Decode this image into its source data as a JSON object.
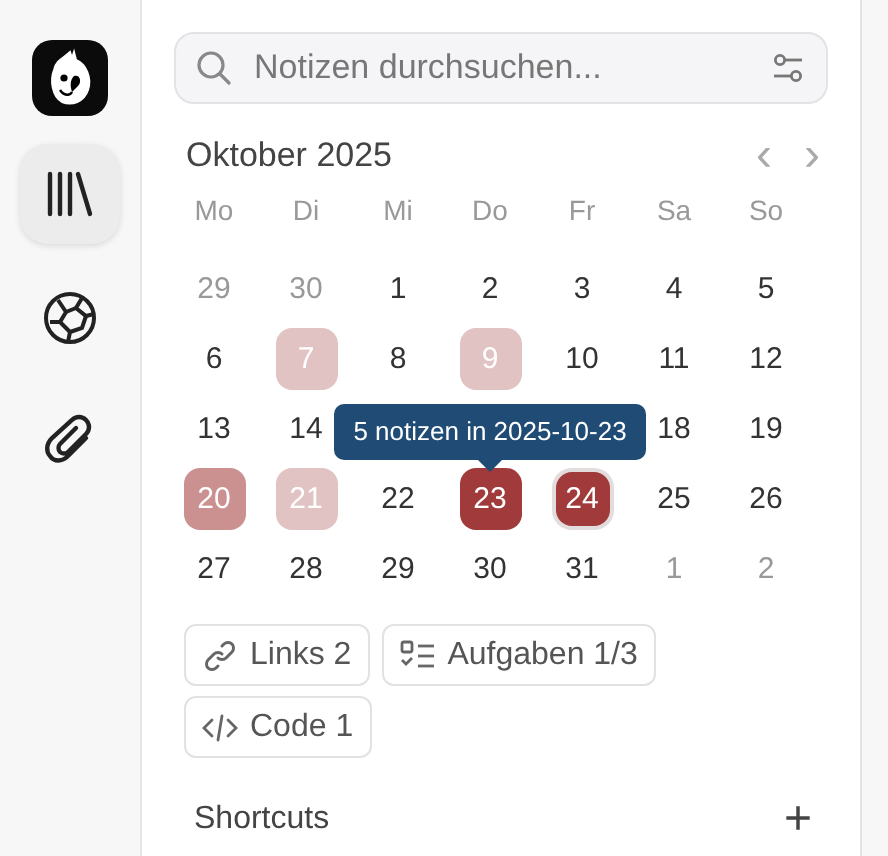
{
  "sidebar": {
    "items": [
      {
        "kind": "library",
        "selected": true
      },
      {
        "kind": "globe",
        "selected": false
      },
      {
        "kind": "attachment",
        "selected": false
      }
    ]
  },
  "search": {
    "placeholder": "Notizen durchsuchen..."
  },
  "calendar": {
    "month": "Oktober 2025",
    "prev": "‹",
    "next": "›",
    "weekdays": [
      "Mo",
      "Di",
      "Mi",
      "Do",
      "Fr",
      "Sa",
      "So"
    ],
    "tooltip": "5 notizen in 2025-10-23",
    "days": [
      {
        "label": "29",
        "in_month": false,
        "today": false
      },
      {
        "label": "30",
        "in_month": false,
        "today": false
      },
      {
        "label": "1",
        "in_month": true,
        "today": false
      },
      {
        "label": "2",
        "in_month": true,
        "today": false
      },
      {
        "label": "3",
        "in_month": true,
        "today": false
      },
      {
        "label": "4",
        "in_month": true,
        "today": false
      },
      {
        "label": "5",
        "in_month": true,
        "today": false
      },
      {
        "label": "6",
        "in_month": true,
        "today": false
      },
      {
        "label": "7",
        "in_month": true,
        "today": false,
        "color": "#e2c3c3"
      },
      {
        "label": "8",
        "in_month": true,
        "today": false
      },
      {
        "label": "9",
        "in_month": true,
        "today": false,
        "color": "#e2c3c3"
      },
      {
        "label": "10",
        "in_month": true,
        "today": false
      },
      {
        "label": "11",
        "in_month": true,
        "today": false
      },
      {
        "label": "12",
        "in_month": true,
        "today": false
      },
      {
        "label": "13",
        "in_month": true,
        "today": false
      },
      {
        "label": "14",
        "in_month": true,
        "today": false
      },
      {
        "label": "18",
        "in_month": true,
        "today": false
      },
      {
        "label": "19",
        "in_month": true,
        "today": false
      },
      {
        "label": "20",
        "in_month": true,
        "today": false,
        "color": "#cb9090"
      },
      {
        "label": "21",
        "in_month": true,
        "today": false,
        "color": "#e2c3c3"
      },
      {
        "label": "22",
        "in_month": true,
        "today": false
      },
      {
        "label": "23",
        "in_month": true,
        "today": false,
        "color": "#a13b3b"
      },
      {
        "label": "24",
        "in_month": true,
        "today": true,
        "color": "#a13b3b"
      },
      {
        "label": "25",
        "in_month": true,
        "today": false
      },
      {
        "label": "26",
        "in_month": true,
        "today": false
      },
      {
        "label": "27",
        "in_month": true,
        "today": false
      },
      {
        "label": "28",
        "in_month": true,
        "today": false
      },
      {
        "label": "29",
        "in_month": true,
        "today": false
      },
      {
        "label": "30",
        "in_month": true,
        "today": false
      },
      {
        "label": "31",
        "in_month": true,
        "today": false
      },
      {
        "label": "1",
        "in_month": false,
        "today": false
      },
      {
        "label": "2",
        "in_month": false,
        "today": false
      }
    ]
  },
  "chips": [
    {
      "kind": "links",
      "label": "Links 2"
    },
    {
      "kind": "tasks",
      "label": "Aufgaben 1/3"
    },
    {
      "kind": "code",
      "label": "Code 1"
    }
  ],
  "shortcuts": {
    "title": "Shortcuts",
    "add": "+"
  }
}
